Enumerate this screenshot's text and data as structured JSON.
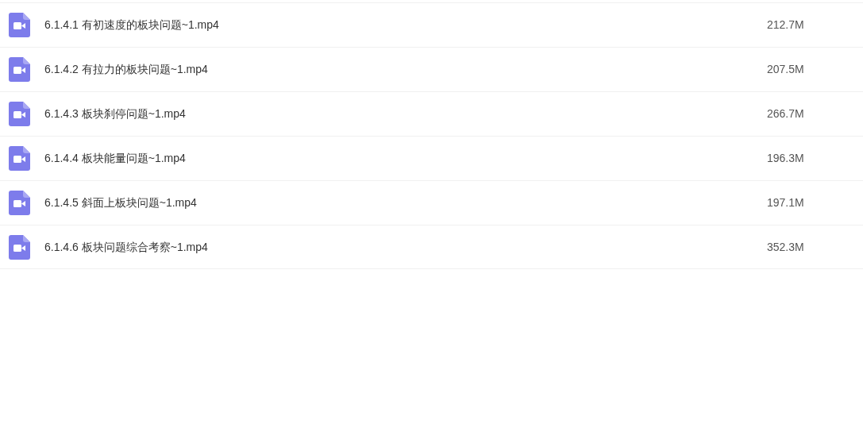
{
  "files": [
    {
      "name": "6.1.4.1 有初速度的板块问题~1.mp4",
      "size": "212.7M"
    },
    {
      "name": "6.1.4.2 有拉力的板块问题~1.mp4",
      "size": "207.5M"
    },
    {
      "name": "6.1.4.3 板块刹停问题~1.mp4",
      "size": "266.7M"
    },
    {
      "name": "6.1.4.4 板块能量问题~1.mp4",
      "size": "196.3M"
    },
    {
      "name": "6.1.4.5 斜面上板块问题~1.mp4",
      "size": "197.1M"
    },
    {
      "name": "6.1.4.6 板块问题综合考察~1.mp4",
      "size": "352.3M"
    }
  ]
}
